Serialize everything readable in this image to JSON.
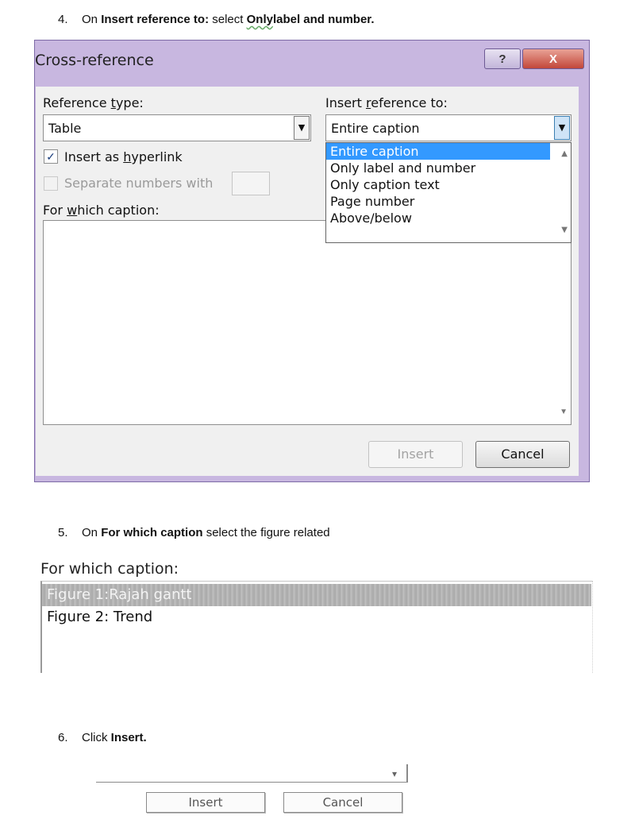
{
  "steps": [
    {
      "number": "4.",
      "prefix": "On ",
      "bold1": "Insert reference to:",
      "mid": " select ",
      "bold2": "Only",
      "bold3": "label and number."
    },
    {
      "number": "5.",
      "prefix": "On ",
      "bold1": "For which caption",
      "rest": " select the figure related"
    },
    {
      "number": "6.",
      "prefix": "Click ",
      "bold1": "Insert."
    }
  ],
  "dialog": {
    "title": "Cross-reference",
    "help_glyph": "?",
    "close_glyph": "X",
    "reference_type": {
      "label_pre": "Reference ",
      "label_u": "t",
      "label_post": "ype:",
      "value": "Table"
    },
    "insert_reference": {
      "label_pre": "Insert ",
      "label_u": "r",
      "label_post": "eference to:",
      "value": "Entire caption"
    },
    "insert_as_hyperlink": {
      "label_pre": "Insert as ",
      "label_u": "h",
      "label_post": "yperlink",
      "checked": true
    },
    "separate_numbers": {
      "label": "Separate numbers with",
      "checked": false,
      "enabled": false
    },
    "for_which_caption": {
      "label_pre": "For ",
      "label_u": "w",
      "label_post": "hich caption:"
    },
    "dropdown_options": [
      "Entire caption",
      "Only label and number",
      "Only caption text",
      "Page number",
      "Above/below"
    ],
    "selected_option": "Entire caption",
    "buttons": {
      "insert": "Insert",
      "cancel": "Cancel"
    }
  },
  "scan1": {
    "label": "For which caption:",
    "items": [
      "Figure 1:Rajah gantt",
      "Figure 2: Trend"
    ],
    "selected": "Figure 1:Rajah gantt"
  },
  "scan2": {
    "buttons": {
      "insert": "Insert",
      "cancel": "Cancel"
    }
  },
  "colors": {
    "selection": "#3399ff",
    "title_bar": "#c8b7e0",
    "close_button": "#c2473a"
  }
}
